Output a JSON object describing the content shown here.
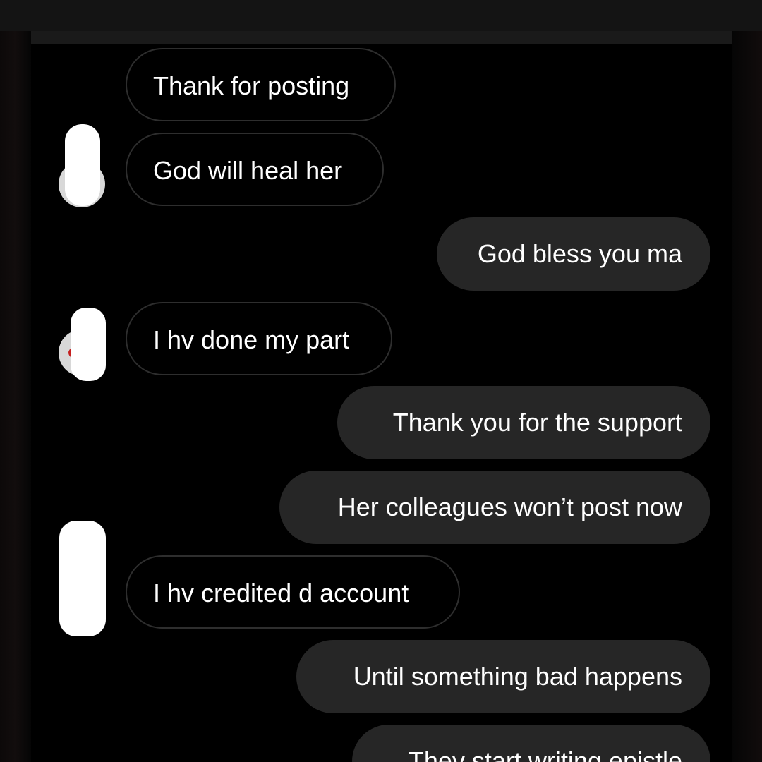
{
  "conversation": {
    "messages": [
      {
        "direction": "received",
        "text": "Thank for posting"
      },
      {
        "direction": "received",
        "text": "God will heal her"
      },
      {
        "direction": "sent",
        "text": "God bless you ma"
      },
      {
        "direction": "received",
        "text": "I hv done my part"
      },
      {
        "direction": "sent",
        "text": "Thank you for the support"
      },
      {
        "direction": "sent",
        "text": "Her colleagues won’t post now"
      },
      {
        "direction": "received",
        "text": "I hv credited d account"
      },
      {
        "direction": "sent",
        "text": "Until something bad happens"
      },
      {
        "direction": "sent",
        "text": "They start writing epistle"
      }
    ],
    "avatar_icon": "profile-avatar-icon",
    "colors": {
      "background": "#000000",
      "sent_bubble": "#262626",
      "received_border": "#2e2e2e",
      "text": "#ffffff",
      "redaction": "#ffffff"
    }
  }
}
